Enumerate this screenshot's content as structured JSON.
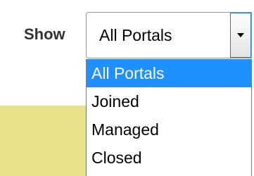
{
  "filter": {
    "label": "Show",
    "selected_value": "All Portals",
    "options": [
      "All Portals",
      "Joined",
      "Managed",
      "Closed"
    ],
    "highlighted_option": "All Portals"
  },
  "colors": {
    "highlight": "#1e90ff",
    "panel": "#e7e28a",
    "label_text": "#333333"
  },
  "icons": {
    "dropdown": "chevron-down-icon"
  }
}
